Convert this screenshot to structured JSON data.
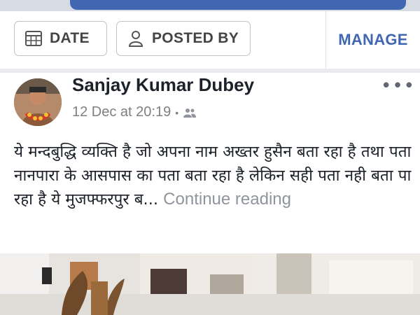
{
  "filters": {
    "date_label": "DATE",
    "posted_by_label": "POSTED BY",
    "manage_label": "MANAGE"
  },
  "post": {
    "author": "Sanjay Kumar Dubey",
    "timestamp": "12 Dec at 20:19",
    "audience_icon": "friends-icon",
    "more_label": "•••",
    "text": "ये मन्दबुद्धि व्यक्ति है जो अपना नाम अख्तर हुसैन बता रहा है तथा पता नानपारा के आसपास का पता बता रहा है लेकिन सही पता नही बता पा रहा है ये मुजफ्फरपुर ब...",
    "continue_label": "Continue reading"
  },
  "colors": {
    "brand_blue": "#4267b2",
    "text": "#1d2129",
    "muted": "#90949c"
  }
}
